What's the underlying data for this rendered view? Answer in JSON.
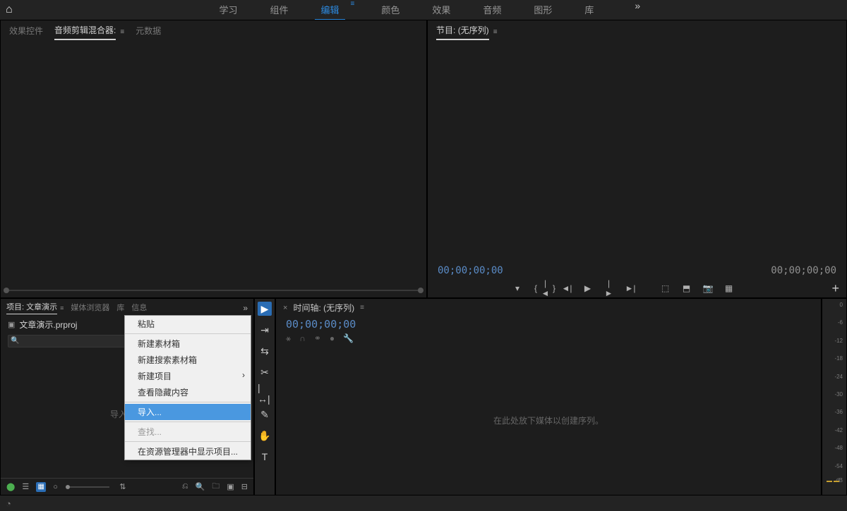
{
  "titlebar": {
    "workspaces": [
      "学习",
      "组件",
      "编辑",
      "颜色",
      "效果",
      "音频",
      "图形",
      "库"
    ],
    "active_workspace": "编辑"
  },
  "upper_left": {
    "tabs": [
      "效果控件",
      "音频剪辑混合器:",
      "元数据"
    ],
    "active_tab": "音频剪辑混合器:"
  },
  "upper_right": {
    "title_prefix": "节目:",
    "title": "(无序列)",
    "timecode_left": "00;00;00;00",
    "timecode_right": "00;00;00;00"
  },
  "project": {
    "tabs": [
      "项目: 文章演示",
      "媒体浏览器",
      "库",
      "信息"
    ],
    "active_tab": "项目: 文章演示",
    "file_name": "文章演示.prproj",
    "placeholder_hint": "导入媒体"
  },
  "context_menu": {
    "items": [
      {
        "label": "粘贴",
        "enabled": true
      },
      {
        "sep": true
      },
      {
        "label": "新建素材箱",
        "enabled": true
      },
      {
        "label": "新建搜索素材箱",
        "enabled": true
      },
      {
        "label": "新建项目",
        "enabled": true,
        "sub": true
      },
      {
        "label": "查看隐藏内容",
        "enabled": true
      },
      {
        "sep": true
      },
      {
        "label": "导入...",
        "enabled": true,
        "highlight": true
      },
      {
        "sep": true
      },
      {
        "label": "查找...",
        "enabled": false
      },
      {
        "sep": true
      },
      {
        "label": "在资源管理器中显示项目...",
        "enabled": true
      }
    ]
  },
  "timeline": {
    "title_prefix": "时间轴:",
    "title": "(无序列)",
    "timecode": "00;00;00;00",
    "placeholder": "在此处放下媒体以创建序列。"
  },
  "audio_meter": {
    "ticks": [
      "0",
      "-6",
      "-12",
      "-18",
      "-24",
      "-30",
      "-36",
      "-42",
      "-48",
      "-54",
      "dB"
    ]
  }
}
